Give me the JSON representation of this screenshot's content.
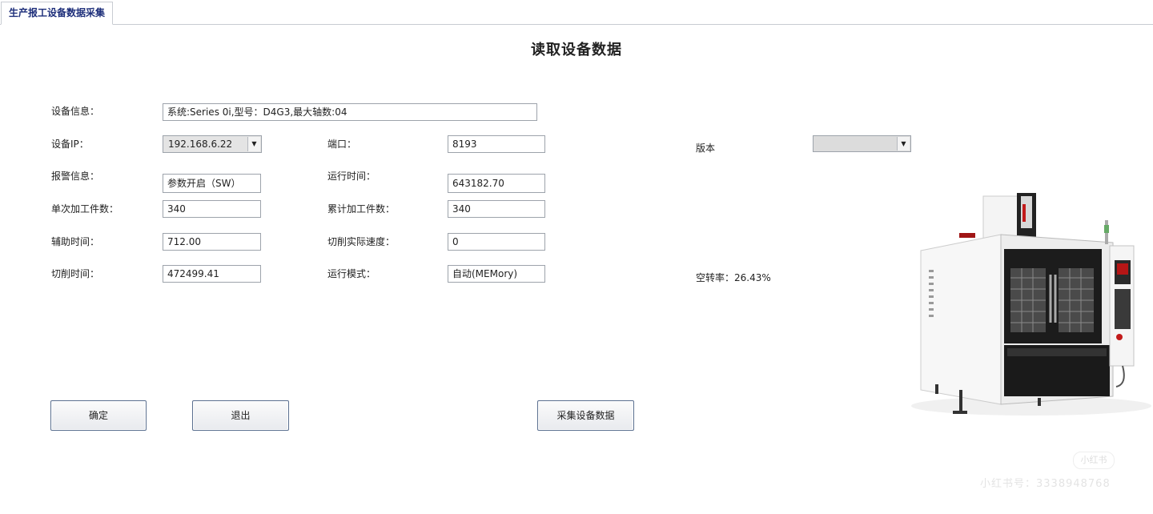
{
  "tab": {
    "label": "生产报工设备数据采集"
  },
  "title": "读取设备数据",
  "fields": {
    "device_info": {
      "label": "设备信息：",
      "value": "系统:Series 0i,型号：D4G3,最大轴数:04"
    },
    "device_ip": {
      "label": "设备IP：",
      "value": "192.168.6.22"
    },
    "port": {
      "label": "端口：",
      "value": "8193"
    },
    "version": {
      "label": "版本",
      "value": ""
    },
    "alarm_info": {
      "label": "报警信息：",
      "value": "参数开启（SW）"
    },
    "run_time": {
      "label": "运行时间：",
      "value": "643182.70"
    },
    "single_count": {
      "label": "单次加工件数：",
      "value": "340"
    },
    "total_count": {
      "label": "累计加工件数：",
      "value": "340"
    },
    "aux_time": {
      "label": "辅助时间：",
      "value": "712.00"
    },
    "cut_speed": {
      "label": "切削实际速度：",
      "value": "0"
    },
    "cut_time": {
      "label": "切削时间：",
      "value": "472499.41"
    },
    "run_mode": {
      "label": "运行模式：",
      "value": "自动(MEMory)"
    },
    "idle_rate": {
      "label": "空转率：26.43%"
    }
  },
  "buttons": {
    "confirm": "确定",
    "exit": "退出",
    "collect": "采集设备数据"
  },
  "icons": {
    "dropdown": "chevron-down-icon",
    "machine": "cnc-machine-image"
  },
  "watermark": {
    "badge": "小红书",
    "text": "小红书号：3338948768"
  },
  "colors": {
    "tab_text": "#1d2e7a",
    "button_border": "#5a6f8f",
    "field_border": "#9da3ab"
  }
}
